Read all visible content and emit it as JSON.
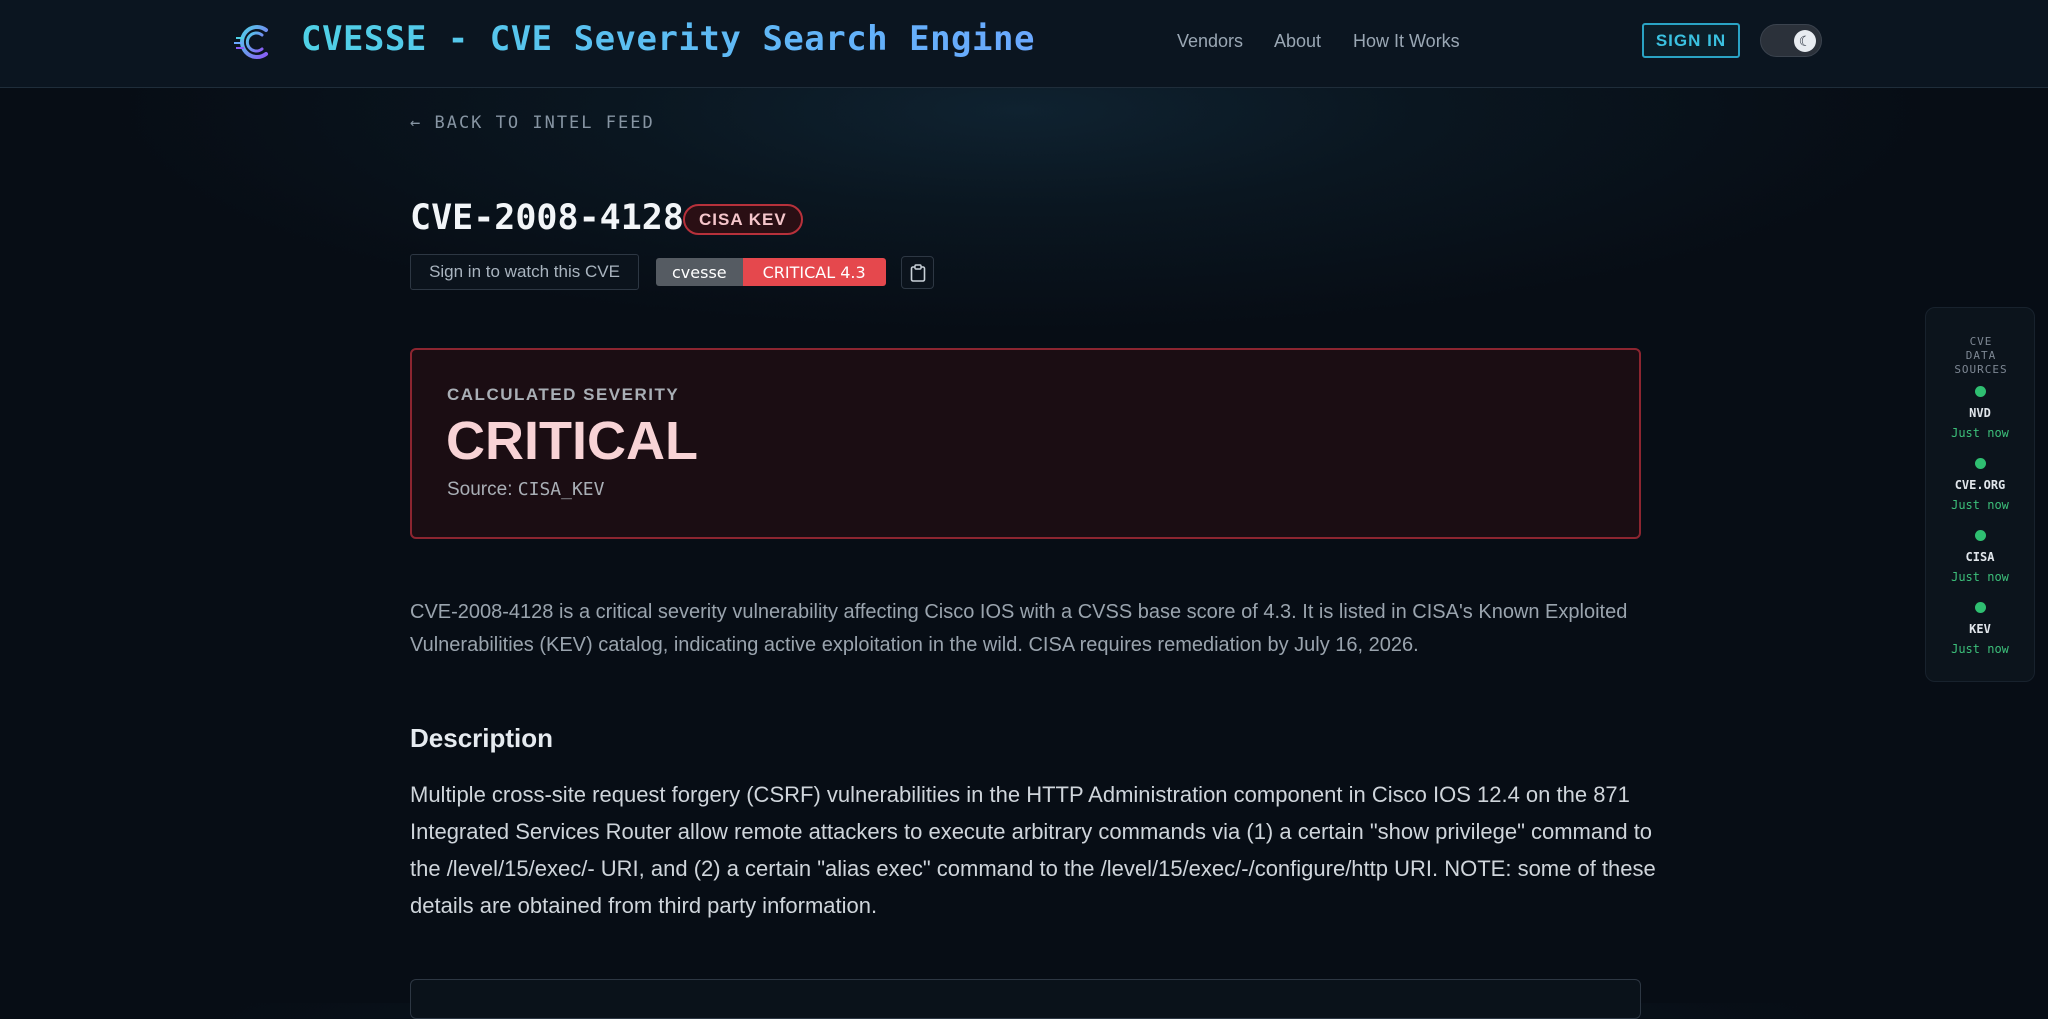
{
  "header": {
    "brand": "CVESSE - CVE Severity Search Engine",
    "nav": [
      "Vendors",
      "About",
      "How It Works"
    ],
    "sign_in": "SIGN IN",
    "theme_toggle_glyph": "☾"
  },
  "back_link": "← BACK TO INTEL FEED",
  "cve": {
    "id": "CVE-2008-4128",
    "kev_badge": "CISA KEV",
    "watch_label": "Sign in to watch this CVE",
    "shield_left": "cvesse",
    "shield_right": "CRITICAL 4.3"
  },
  "severity": {
    "label": "CALCULATED SEVERITY",
    "value": "CRITICAL",
    "source_prefix": "Source: ",
    "source": "CISA_KEV"
  },
  "summary": "CVE-2008-4128 is a critical severity vulnerability affecting Cisco IOS with a CVSS base score of 4.3. It is listed in CISA's Known Exploited Vulnerabilities (KEV) catalog, indicating active exploitation in the wild. CISA requires remediation by July 16, 2026.",
  "description": {
    "title": "Description",
    "body": "Multiple cross-site request forgery (CSRF) vulnerabilities in the HTTP Administration component in Cisco IOS 12.4 on the 871 Integrated Services Router allow remote attackers to execute arbitrary commands via (1) a certain \"show privilege\" command to the /level/15/exec/- URI, and (2) a certain \"alias exec\" command to the /level/15/exec/-/configure/http URI. NOTE: some of these details are obtained from third party information."
  },
  "data_sources": {
    "title": "CVE DATA SOURCES",
    "items": [
      {
        "name": "NVD",
        "status": "Just now"
      },
      {
        "name": "CVE.ORG",
        "status": "Just now"
      },
      {
        "name": "CISA",
        "status": "Just now"
      },
      {
        "name": "KEV",
        "status": "Just now"
      }
    ]
  },
  "colors": {
    "accent": "#3bc1e0",
    "critical": "#e5484d",
    "ok": "#2fbf71"
  }
}
